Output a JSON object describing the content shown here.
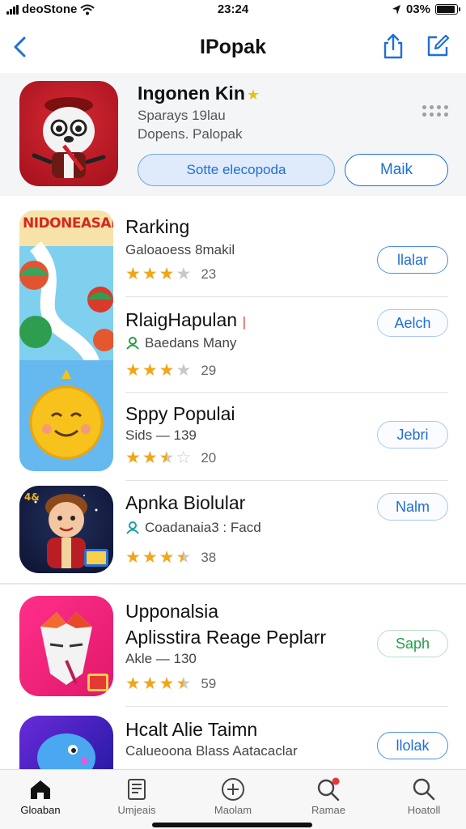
{
  "status_bar": {
    "carrier": "deoStone",
    "time": "23:24",
    "battery": "03%",
    "battery_level": 0.9
  },
  "nav": {
    "title": "IPopak"
  },
  "featured": {
    "title": "Ingonen Kin",
    "subtitle1": "Sparays 19lau",
    "subtitle2": "Dopens. Palopak",
    "primary_button": "Sotte elecopoda",
    "secondary_button": "Maik"
  },
  "big_icon_label": "NIDONEASAI",
  "apps": [
    {
      "title": "Rarking",
      "subtitle": "Galoaoess 8makil",
      "rating": 3,
      "count": "23",
      "button": "llalar",
      "button_style": "dark"
    },
    {
      "title": "RlaigHapulan",
      "subtitle": "Baedans Many",
      "rating": 3,
      "count": "29",
      "button": "Aelch",
      "button_style": "light",
      "sub_icon": "people-icon"
    },
    {
      "title": "Sppy Populai",
      "subtitle": "Sids — 139",
      "rating": 2.5,
      "count": "20",
      "button": "Jebri",
      "button_style": "light"
    },
    {
      "title": "Apnka Biolular",
      "subtitle": "Coadanaia3 : Facd",
      "rating": 3.5,
      "count": "38",
      "button": "Nalm",
      "button_style": "light",
      "sub_icon": "people-icon"
    },
    {
      "title": "Upponalsia",
      "title2": "Aplisstira Reage Peplarr",
      "subtitle": "Akle — 130",
      "rating": 3.5,
      "count": "59",
      "button": "Saph",
      "button_style": "green"
    },
    {
      "title": "Hcalt Alie Taimn",
      "subtitle": "Calueoona Blass Aatacaclar",
      "button": "llolak",
      "button_style": "dark"
    }
  ],
  "tabs": [
    {
      "label": "Gloaban",
      "icon": "home-icon",
      "active": true
    },
    {
      "label": "Umjeais",
      "icon": "document-icon"
    },
    {
      "label": "Maolam",
      "icon": "add-circle-icon"
    },
    {
      "label": "Ramae",
      "icon": "search-badge-icon"
    },
    {
      "label": "Hoatoll",
      "icon": "search-icon"
    }
  ],
  "colors": {
    "accent": "#1f6fd6",
    "star": "#f2a516",
    "green": "#21a04a",
    "badge": "#e53935"
  }
}
